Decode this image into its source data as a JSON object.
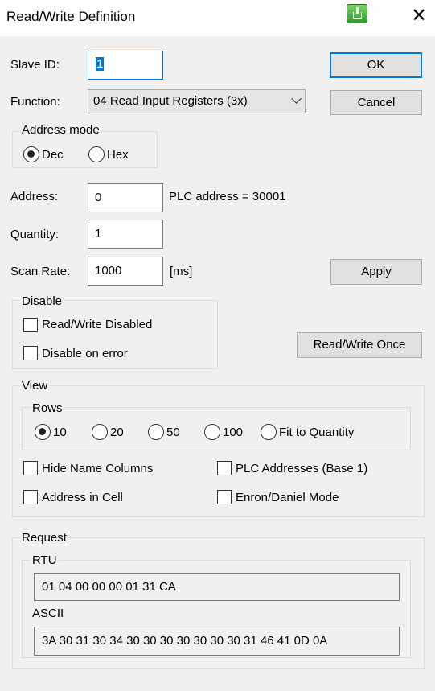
{
  "window": {
    "title": "Read/Write Definition",
    "close_glyph": "✕"
  },
  "slave_id": {
    "label": "Slave ID:",
    "value": "1"
  },
  "function": {
    "label": "Function:",
    "selected": "04 Read Input Registers (3x)"
  },
  "buttons": {
    "ok": "OK",
    "cancel": "Cancel",
    "apply": "Apply",
    "read_write_once": "Read/Write Once"
  },
  "address_mode": {
    "title": "Address mode",
    "options": [
      "Dec",
      "Hex"
    ],
    "selected": "Dec"
  },
  "address": {
    "label": "Address:",
    "value": "0",
    "plc_note": "PLC address = 30001"
  },
  "quantity": {
    "label": "Quantity:",
    "value": "1"
  },
  "scan_rate": {
    "label": "Scan Rate:",
    "value": "1000",
    "unit": "[ms]"
  },
  "disable": {
    "title": "Disable",
    "read_write_disabled": "Read/Write Disabled",
    "disable_on_error": "Disable on error"
  },
  "view": {
    "title": "View",
    "rows": {
      "title": "Rows",
      "options": [
        "10",
        "20",
        "50",
        "100",
        "Fit to Quantity"
      ],
      "selected": "10"
    },
    "hide_name_columns": "Hide Name Columns",
    "plc_addresses": "PLC Addresses (Base 1)",
    "address_in_cell": "Address in Cell",
    "enron_daniel_mode": "Enron/Daniel Mode"
  },
  "request": {
    "title": "Request",
    "rtu_title": "RTU",
    "rtu_value": "01 04 00 00 00 01 31 CA",
    "ascii_title": "ASCII",
    "ascii_value": "3A 30 31 30 34 30 30 30 30 30 30 30 31 46 41 0D 0A"
  },
  "icons": {
    "app_icon": "green-download-icon",
    "close": "close-icon",
    "dropdown": "chevron-down-icon"
  },
  "colors": {
    "accent": "#0078d7",
    "face": "#f0f0f0",
    "button": "#e1e1e1"
  }
}
